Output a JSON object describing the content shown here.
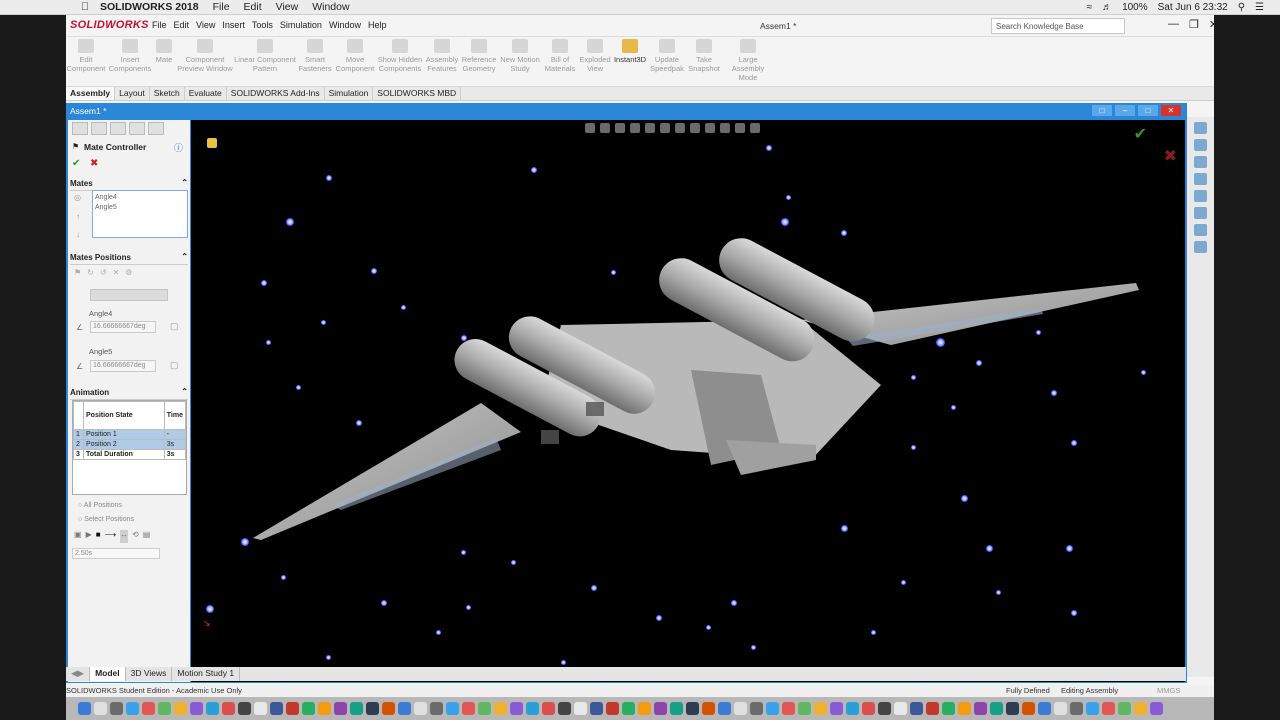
{
  "mac": {
    "app_name": "SOLIDWORKS 2018",
    "menu": [
      "File",
      "Edit",
      "View",
      "Window"
    ],
    "battery": "100%",
    "clock": "Sat Jun 6  23:32"
  },
  "sw": {
    "logo": "SOLIDWORKS",
    "menu": [
      "File",
      "Edit",
      "View",
      "Insert",
      "Tools",
      "Simulation",
      "Window",
      "Help"
    ],
    "doc_title": "Assem1 *",
    "search_placeholder": "Search Knowledge Base",
    "ribbon": [
      {
        "label": "Edit Component",
        "active": false
      },
      {
        "label": "Insert Components",
        "active": false
      },
      {
        "label": "Mate",
        "active": false
      },
      {
        "label": "Component Preview Window",
        "active": false
      },
      {
        "label": "Linear Component Pattern",
        "active": false
      },
      {
        "label": "Smart Fasteners",
        "active": false
      },
      {
        "label": "Move Component",
        "active": false
      },
      {
        "label": "Show Hidden Components",
        "active": false
      },
      {
        "label": "Assembly Features",
        "active": false
      },
      {
        "label": "Reference Geometry",
        "active": false
      },
      {
        "label": "New Motion Study",
        "active": false
      },
      {
        "label": "Bill of Materials",
        "active": false
      },
      {
        "label": "Exploded View",
        "active": false
      },
      {
        "label": "Instant3D",
        "active": true
      },
      {
        "label": "Update Speedpak",
        "active": false
      },
      {
        "label": "Take Snapshot",
        "active": false
      },
      {
        "label": "Large Assembly Mode",
        "active": false
      }
    ],
    "command_tabs": [
      "Assembly",
      "Layout",
      "Sketch",
      "Evaluate",
      "SOLIDWORKS Add-Ins",
      "Simulation",
      "SOLIDWORKS MBD"
    ],
    "doc_tab": "Assem1 *",
    "pm": {
      "title": "Mate Controller",
      "mates_header": "Mates",
      "mates": [
        "Angle4",
        "Angle5"
      ],
      "positions_header": "Mates Positions",
      "angle4_label": "Angle4",
      "angle4_value": "16.66666667deg",
      "angle5_label": "Angle5",
      "angle5_value": "16.66666667deg",
      "animation_header": "Animation",
      "col_state": "Position State",
      "col_time": "Time",
      "rows": [
        {
          "n": "1",
          "state": "Position 1",
          "time": "-"
        },
        {
          "n": "2",
          "state": "Position 2",
          "time": "3s"
        },
        {
          "n": "3",
          "state": "Total Duration",
          "time": "3s"
        }
      ],
      "radio_all": "All Positions",
      "radio_select": "Select Positions",
      "duration": "2.50s"
    },
    "bottom_tabs": [
      "Model",
      "3D Views",
      "Motion Study 1"
    ],
    "status_left": "SOLIDWORKS Student Edition - Academic Use Only",
    "status_fully": "Fully Defined",
    "status_editing": "Editing Assembly",
    "status_units": "MMGS"
  }
}
